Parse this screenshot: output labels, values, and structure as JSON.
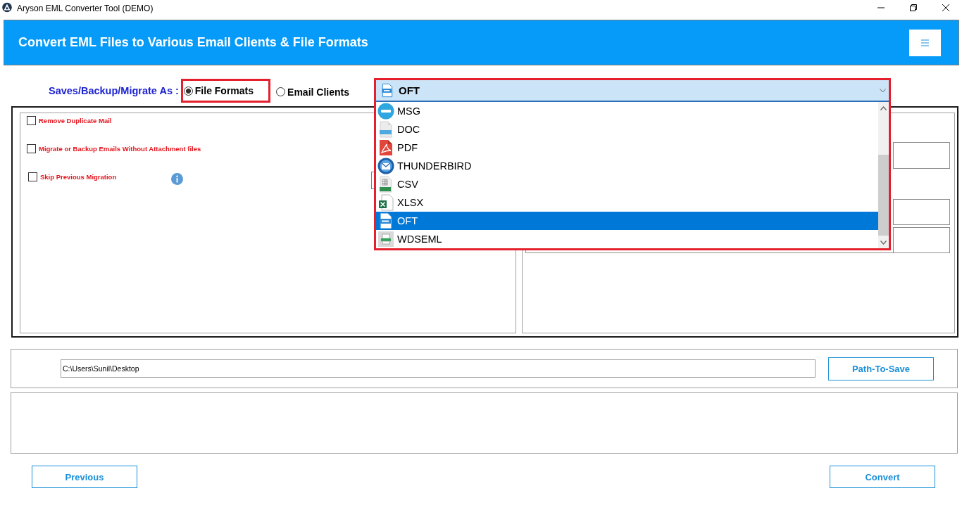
{
  "window": {
    "title": "Aryson EML Converter Tool (DEMO)"
  },
  "header": {
    "title": "Convert EML Files to Various Email Clients & File Formats"
  },
  "save_as": {
    "label": "Saves/Backup/Migrate As :",
    "options": [
      {
        "label": "File Formats",
        "selected": true,
        "highlighted": true
      },
      {
        "label": "Email Clients",
        "selected": false,
        "highlighted": false
      }
    ]
  },
  "format_dropdown": {
    "value": "OFT",
    "kind": "oft",
    "expanded": true,
    "highlighted": true,
    "options": [
      {
        "label": "MSG",
        "kind": "msg",
        "selected": false
      },
      {
        "label": "DOC",
        "kind": "doc",
        "selected": false
      },
      {
        "label": "PDF",
        "kind": "pdf",
        "selected": false
      },
      {
        "label": "THUNDERBIRD",
        "kind": "thunderbird",
        "selected": false
      },
      {
        "label": "CSV",
        "kind": "csv",
        "selected": false
      },
      {
        "label": "XLSX",
        "kind": "xlsx",
        "selected": false
      },
      {
        "label": "OFT",
        "kind": "oft",
        "selected": true
      },
      {
        "label": "WDSEML",
        "kind": "wdseml",
        "selected": false
      }
    ]
  },
  "options": [
    {
      "label": "Remove Duplicate Mail",
      "checked": false,
      "info": false
    },
    {
      "label": "Migrate or Backup Emails Without Attachment files",
      "checked": false,
      "info": false
    },
    {
      "label": "Skip Previous Migration",
      "checked": false,
      "info": true
    }
  ],
  "path": {
    "value": "C:\\Users\\Sunil\\Desktop",
    "button": "Path-To-Save"
  },
  "buttons": [
    "Previous",
    "Convert"
  ]
}
